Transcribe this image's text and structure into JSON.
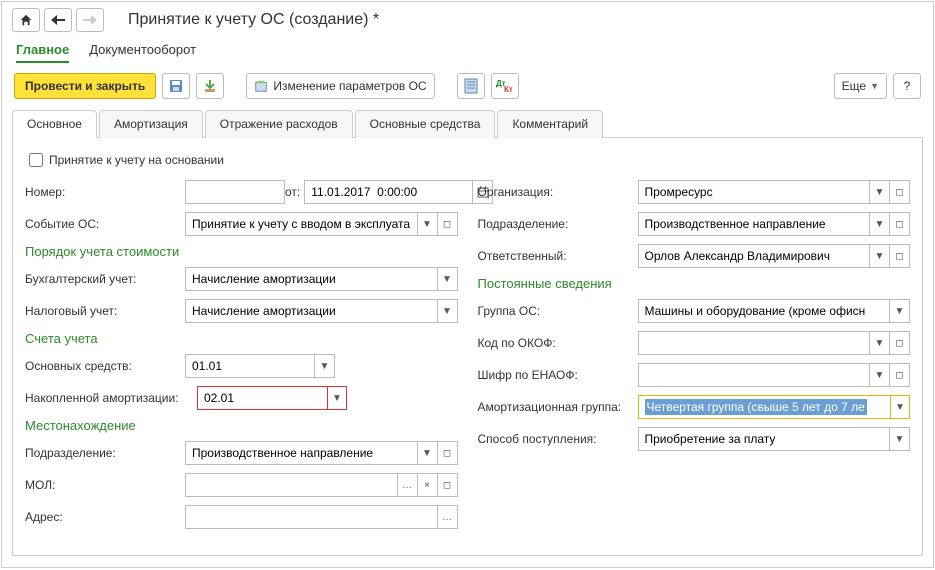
{
  "title": "Принятие к учету ОС (создание) *",
  "mode_tabs": {
    "main": "Главное",
    "workflow": "Документооборот"
  },
  "toolbar": {
    "post_close": "Провести и закрыть",
    "change_params": "Изменение параметров ОС",
    "more": "Еще",
    "help": "?"
  },
  "tabs": {
    "main": "Основное",
    "amort": "Амортизация",
    "expense": "Отражение расходов",
    "assets": "Основные средства",
    "comment": "Комментарий"
  },
  "left": {
    "based_on_label": "Принятие к учету на основании",
    "number_label": "Номер:",
    "from_label": "от:",
    "date_value": "11.01.2017  0:00:00",
    "event_label": "Событие ОС:",
    "event_value": "Принятие к учету с вводом в эксплуата",
    "cost_section": "Порядок учета стоимости",
    "bu_label": "Бухгалтерский учет:",
    "bu_value": "Начисление амортизации",
    "nu_label": "Налоговый учет:",
    "nu_value": "Начисление амортизации",
    "accounts_section": "Счета учета",
    "fa_acc_label": "Основных средств:",
    "fa_acc_value": "01.01",
    "depr_acc_label": "Накопленной амортизации:",
    "depr_acc_value": "02.01",
    "location_section": "Местонахождение",
    "dept_label": "Подразделение:",
    "dept_value": "Производственное направление",
    "mol_label": "МОЛ:",
    "mol_value": "",
    "addr_label": "Адрес:",
    "addr_value": ""
  },
  "right": {
    "org_label": "Организация:",
    "org_value": "Промресурс",
    "dept_label": "Подразделение:",
    "dept_value": "Производственное направление",
    "resp_label": "Ответственный:",
    "resp_value": "Орлов Александр Владимирович",
    "const_section": "Постоянные сведения",
    "group_label": "Группа ОС:",
    "group_value": "Машины и оборудование (кроме офисн",
    "okof_label": "Код по ОКОФ:",
    "okof_value": "",
    "enaof_label": "Шифр по ЕНАОФ:",
    "enaof_value": "",
    "amort_group_label": "Амортизационная группа:",
    "amort_group_value": "Четвертая группа (свыше 5 лет до 7 ле",
    "receipt_label": "Способ поступления:",
    "receipt_value": "Приобретение за плату"
  }
}
